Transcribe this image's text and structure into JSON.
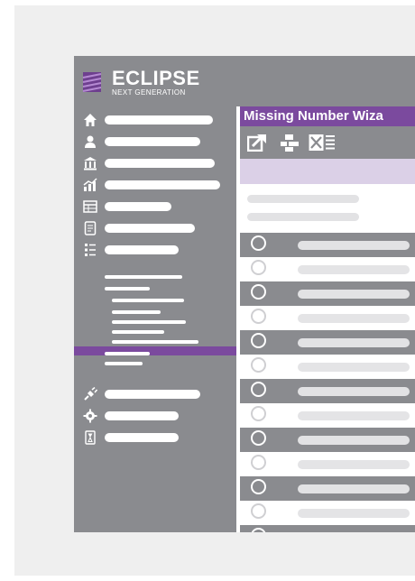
{
  "app": {
    "brand": "ECLIPSE",
    "brand_sub": "NEXT GENERATION"
  },
  "sidebar": {
    "items": [
      {
        "icon": "home-icon"
      },
      {
        "icon": "user-icon"
      },
      {
        "icon": "bank-icon"
      },
      {
        "icon": "chart-icon"
      },
      {
        "icon": "table-icon"
      },
      {
        "icon": "document-icon"
      },
      {
        "icon": "list-icon"
      },
      {
        "icon": "plug-icon"
      },
      {
        "icon": "gear-icon"
      },
      {
        "icon": "timer-icon"
      }
    ],
    "active_subitem": 2
  },
  "window": {
    "title": "Missing Number Wiza"
  },
  "toolbar": {
    "buttons": [
      "export-icon",
      "workflow-icon",
      "excel-icon"
    ]
  },
  "colors": {
    "accent": "#7b4a9e",
    "panel_gray": "#8a8b8f",
    "lavender": "#dbd0e7"
  }
}
